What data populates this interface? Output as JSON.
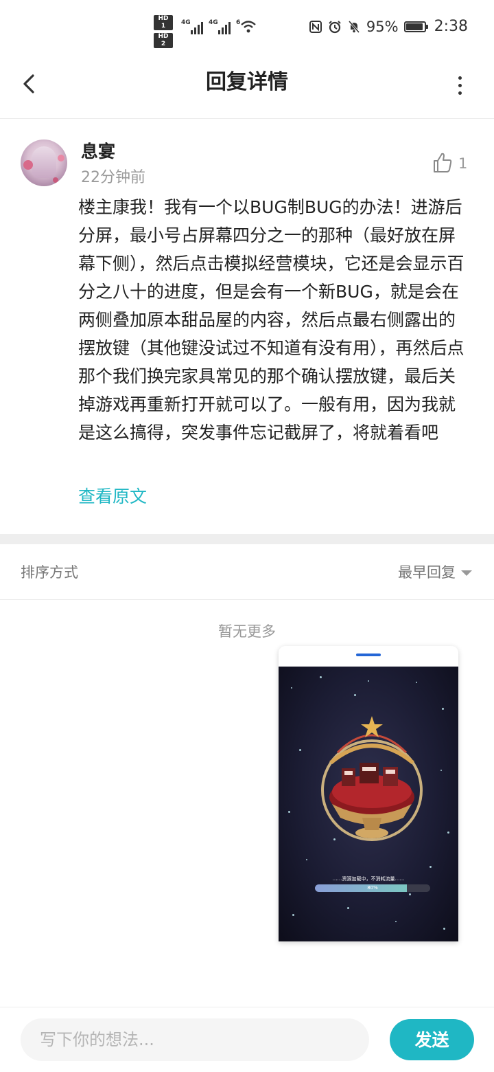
{
  "status_bar": {
    "hd1": "HD 1",
    "hd2": "HD 2",
    "net1": "4G",
    "net2": "4G",
    "wifi": "6",
    "battery": "95%",
    "battery_level": 0.95,
    "time": "2:38"
  },
  "header": {
    "title": "回复详情"
  },
  "reply": {
    "author": "息宴",
    "time": "22分钟前",
    "likes": "1",
    "content": "楼主康我！我有一个以BUG制BUG的办法！进游后分屏，最小号占屏幕四分之一的那种（最好放在屏幕下侧），然后点击模拟经营模块，它还是会显示百分之八十的进度，但是会有一个新BUG，就是会在两侧叠加原本甜品屋的内容，然后点最右侧露出的摆放键（其他键没试过不知道有没有用），再然后点那个我们换完家具常见的那个确认摆放键，最后关掉游戏再重新打开就可以了。一般有用，因为我就是这么搞得，突发事件忘记截屏了，将就着看吧",
    "view_original": "查看原文"
  },
  "sort": {
    "label": "排序方式",
    "value": "最早回复"
  },
  "list": {
    "empty_text": "暂无更多"
  },
  "preview": {
    "loading_text": "……资源加载中，不消耗流量……",
    "progress_label": "80%",
    "progress": 0.8
  },
  "composer": {
    "placeholder": "写下你的想法...",
    "send_label": "发送"
  },
  "colors": {
    "accent": "#1fb7c4"
  }
}
